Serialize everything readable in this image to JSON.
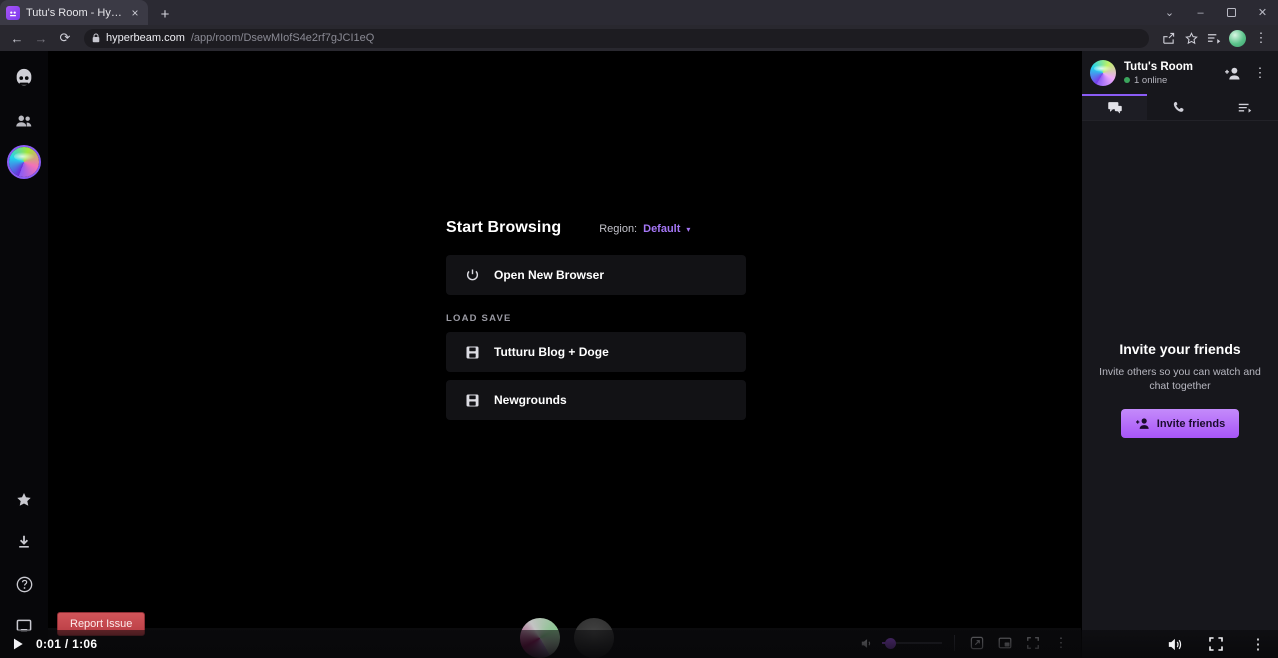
{
  "browser": {
    "tab": {
      "title": "Tutu's Room - Hyperbeam",
      "favicon_name": "hyperbeam-favicon",
      "close_glyph": "×"
    },
    "newtab_glyph": "+",
    "window_controls": {
      "expand": "⌄",
      "minimize": "–",
      "maximize": "❐",
      "close": "✕"
    },
    "nav": {
      "back": "←",
      "forward": "→",
      "reload": "⟳"
    },
    "url": {
      "lock_icon": "lock-icon",
      "host": "hyperbeam.com",
      "path": "/app/room/DsewMIofS4e2rf7gJCI1eQ"
    },
    "toolbar_right": {
      "share": "share-icon",
      "bookmark": "star-icon",
      "reading_list": "reading-list-icon",
      "profile": "profile-avatar",
      "menu": "⋮"
    }
  },
  "rail": {
    "items": [
      {
        "name": "hyperbeam-logo-icon",
        "label": "Hyperbeam"
      },
      {
        "name": "friends-icon",
        "label": "Friends"
      },
      {
        "name": "room-avatar",
        "label": "Tutu's Room"
      }
    ],
    "bottom_items": [
      {
        "name": "star-icon",
        "label": "Favorites"
      },
      {
        "name": "download-icon",
        "label": "Downloads"
      },
      {
        "name": "help-icon",
        "label": "Help"
      },
      {
        "name": "display-icon",
        "label": "Display"
      }
    ]
  },
  "start": {
    "title": "Start Browsing",
    "region_label": "Region:",
    "region_value": "Default",
    "caret": "▾",
    "open_new_browser": "Open New Browser",
    "section_label": "LOAD SAVE",
    "saves": [
      {
        "name": "Tutturu Blog + Doge",
        "icon": "save-disk-icon"
      },
      {
        "name": "Newgrounds",
        "icon": "save-disk-icon"
      }
    ]
  },
  "stage_bar": {
    "volume_icon": "volume-icon",
    "volume_percent": 6,
    "popout": "popout-icon",
    "pip": "picture-in-picture-icon",
    "fullscreen": "fullscreen-icon",
    "more": "⋮"
  },
  "report": {
    "label": "Report Issue"
  },
  "room": {
    "name": "Tutu's Room",
    "online_text": "1 online",
    "add_person_icon": "add-person-icon",
    "more_icon": "⋮",
    "tabs": [
      {
        "name": "chat",
        "icon": "chat-icon",
        "active": true
      },
      {
        "name": "call",
        "icon": "phone-icon",
        "active": false
      },
      {
        "name": "queue",
        "icon": "queue-icon",
        "active": false
      }
    ],
    "invite": {
      "title": "Invite your friends",
      "subtitle": "Invite others so you can watch and chat together",
      "button_label": "Invite friends",
      "button_icon": "add-person-icon"
    }
  },
  "player": {
    "play_icon": "play-icon",
    "current_time": "0:01",
    "separator": "/",
    "duration": "1:06",
    "time_display": "0:01 / 1:06",
    "volume_icon": "volume-icon",
    "fullscreen_icon": "fullscreen-icon",
    "more_icon": "⋮"
  },
  "colors": {
    "accent_purple": "#a855f7",
    "brand_purple": "#8b5cf6",
    "online_green": "#3ba55d",
    "report_red": "#c2474e",
    "stage_black": "#000000",
    "panel_dark": "#17171c"
  }
}
